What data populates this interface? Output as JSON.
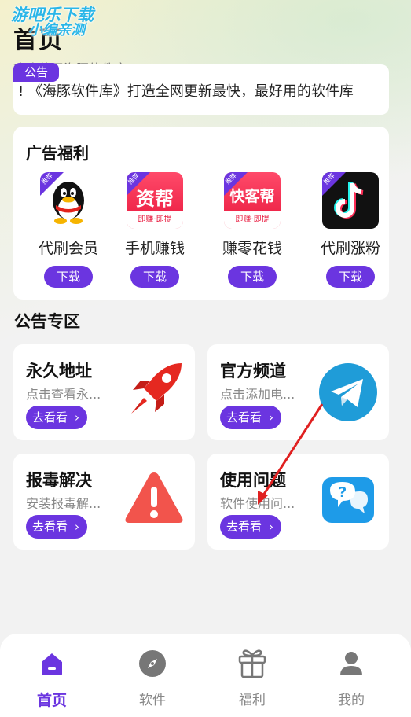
{
  "watermark": {
    "line1": "游吧乐下载",
    "line2": "小编亲测"
  },
  "header": {
    "title": "首页",
    "subtitle": "欢迎使用海豚软件库"
  },
  "notice": {
    "tag": "公告",
    "text": "!    《海豚软件库》打造全网更新最快，最好用的软件库"
  },
  "ads": {
    "title": "广告福利",
    "badge": "推荐",
    "download_label": "下载",
    "items": [
      {
        "name": "代刷会员",
        "icon": "qq-penguin-icon"
      },
      {
        "name": "手机赚钱",
        "icon": "zhuan-bang-icon",
        "logo_text": "资帮",
        "logo_sub": "即赚·即提"
      },
      {
        "name": "赚零花钱",
        "icon": "kuaike-bang-icon",
        "logo_text": "快客帮",
        "logo_sub": "即赚·即提"
      },
      {
        "name": "代刷涨粉",
        "icon": "tiktok-icon"
      }
    ]
  },
  "section": {
    "title": "公告专区"
  },
  "features": [
    {
      "title": "永久地址",
      "desc": "点击查看永...",
      "button": "去看看",
      "icon": "rocket-icon"
    },
    {
      "title": "官方频道",
      "desc": "点击添加电...",
      "button": "去看看",
      "icon": "telegram-icon"
    },
    {
      "title": "报毒解决",
      "desc": "安装报毒解...",
      "button": "去看看",
      "icon": "warning-icon"
    },
    {
      "title": "使用问题",
      "desc": "软件使用问...",
      "button": "去看看",
      "icon": "help-chat-icon"
    }
  ],
  "tabs": [
    {
      "label": "首页",
      "icon": "home-icon",
      "active": true
    },
    {
      "label": "软件",
      "icon": "compass-icon",
      "active": false
    },
    {
      "label": "福利",
      "icon": "gift-icon",
      "active": false
    },
    {
      "label": "我的",
      "icon": "user-icon",
      "active": false
    }
  ],
  "colors": {
    "accent": "#6b35e0",
    "annotation": "#e02020"
  }
}
